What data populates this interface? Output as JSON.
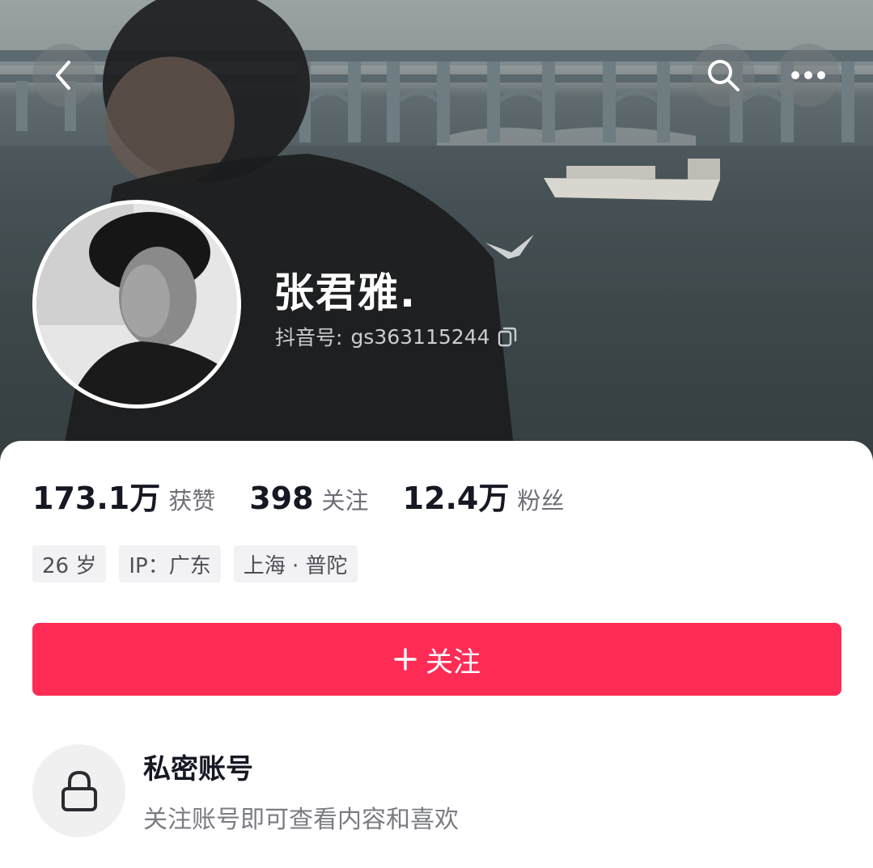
{
  "header": {
    "back_icon": "back-chevron-icon",
    "search_icon": "search-icon",
    "more_icon": "more-dots-icon"
  },
  "profile": {
    "nickname": "张君雅.",
    "douyin_id_label": "抖音号:",
    "douyin_id": "gs363115244",
    "copy_icon": "copy-icon"
  },
  "stats": [
    {
      "value": "173.1万",
      "label": "获赞"
    },
    {
      "value": "398",
      "label": "关注"
    },
    {
      "value": "12.4万",
      "label": "粉丝"
    }
  ],
  "tags": [
    "26 岁",
    "IP：广东",
    "上海 · 普陀"
  ],
  "follow_button": {
    "label": "关注",
    "icon": "plus-icon"
  },
  "private_account": {
    "icon": "lock-icon",
    "title": "私密账号",
    "subtitle": "关注账号即可查看内容和喜欢"
  },
  "colors": {
    "accent": "#fe2c55",
    "text_primary": "#161823",
    "text_secondary": "#6e7077",
    "tag_bg": "#f2f2f4"
  }
}
